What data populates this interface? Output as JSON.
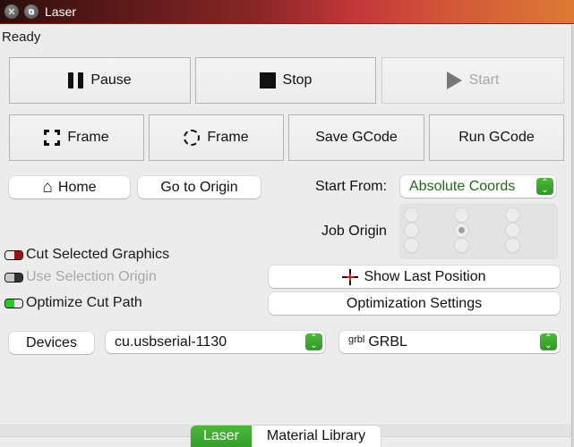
{
  "window": {
    "title": "Laser",
    "close_icon": "close-icon",
    "restore_icon": "restore-icon",
    "titlebar_gradient": [
      "#2a0f0c",
      "#8a2626",
      "#c4373a",
      "#dc7a34"
    ]
  },
  "status": "Ready",
  "job_controls": {
    "pause": {
      "label": "Pause",
      "icon": "pause-icon"
    },
    "stop": {
      "label": "Stop",
      "icon": "stop-icon"
    },
    "start": {
      "label": "Start",
      "icon": "play-icon",
      "disabled": true
    }
  },
  "file_controls": {
    "frame_rect": {
      "label": "Frame",
      "icon": "frame-rectangle-icon"
    },
    "frame_circle": {
      "label": "Frame",
      "icon": "frame-circle-icon"
    },
    "save_gcode": {
      "label": "Save GCode"
    },
    "run_gcode": {
      "label": "Run GCode"
    }
  },
  "position": {
    "home": {
      "label": "Home",
      "icon": "home-icon"
    },
    "go_to_origin": {
      "label": "Go to Origin"
    },
    "start_from_label": "Start From:",
    "start_from_value": "Absolute Coords",
    "job_origin_label": "Job Origin",
    "job_origin_selected": "center"
  },
  "options": {
    "cut_selected": {
      "label": "Cut Selected Graphics",
      "state": "off",
      "color": "#a01010"
    },
    "use_selection_origin": {
      "label": "Use Selection Origin",
      "state": "off",
      "disabled": true
    },
    "optimize_cut_path": {
      "label": "Optimize Cut Path",
      "state": "on",
      "color": "#22cc22"
    },
    "show_last_position": {
      "label": "Show Last Position",
      "icon": "crosshair-icon"
    },
    "optimization_settings": {
      "label": "Optimization Settings"
    }
  },
  "device": {
    "devices_label": "Devices",
    "port_value": "cu.usbserial-1130",
    "controller_logo": "grbl",
    "controller_value": "GRBL"
  },
  "tabs": [
    {
      "label": "Laser",
      "active": true
    },
    {
      "label": "Material Library",
      "active": false
    }
  ],
  "accent_color": "#3aa82e"
}
